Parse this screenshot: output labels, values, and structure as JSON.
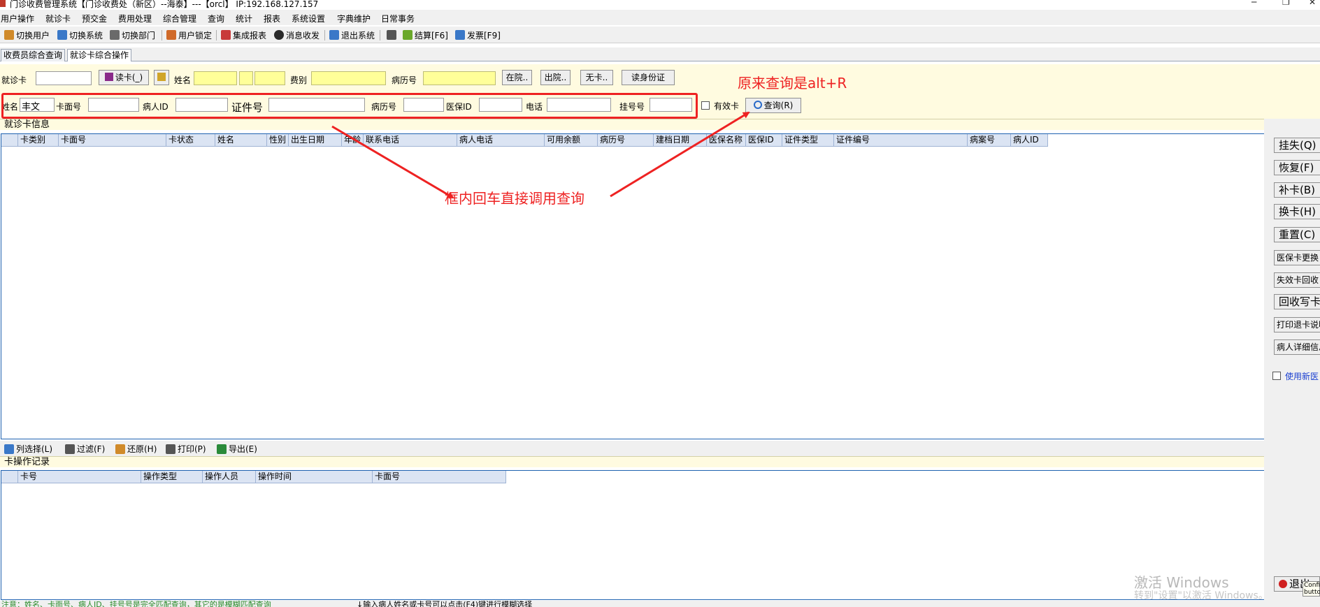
{
  "titlebar": {
    "title": "门诊收费管理系统【门诊收费处（新区）--海泰】---【orcl】 IP:192.168.127.157",
    "minimize": "─",
    "maximize": "❐",
    "close": "✕"
  },
  "menu": [
    "用户操作",
    "就诊卡",
    "预交金",
    "费用处理",
    "综合管理",
    "查询",
    "统计",
    "报表",
    "系统设置",
    "字典维护",
    "日常事务"
  ],
  "toolbar": [
    {
      "label": "切换用户",
      "icon": "user-switch-icon",
      "color": "#d08a2a"
    },
    {
      "label": "切换系统",
      "icon": "system-switch-icon",
      "color": "#3a78c8"
    },
    {
      "label": "切换部门",
      "icon": "department-switch-icon",
      "color": "#6a6a6a"
    },
    {
      "label": "用户锁定",
      "icon": "lock-user-icon",
      "color": "#d06a2a"
    },
    {
      "label": "集成报表",
      "icon": "report-icon",
      "color": "#c83a3a"
    },
    {
      "label": "消息收发",
      "icon": "info-icon",
      "color": "#2a2a2a"
    },
    {
      "label": "退出系统",
      "icon": "exit-icon",
      "color": "#3a78c8"
    },
    {
      "label": "",
      "icon": "edit-icon",
      "color": "#555555"
    },
    {
      "label": "结算[F6]",
      "icon": "settle-icon",
      "color": "#6aa82a"
    },
    {
      "label": "发票[F9]",
      "icon": "invoice-icon",
      "color": "#3a78c8"
    }
  ],
  "tabs": [
    "收费员综合查询",
    "就诊卡综合操作"
  ],
  "row1": {
    "card_label": "就诊卡",
    "read_card": "读卡(_)",
    "name_label": "姓名",
    "feetype_label": "费别",
    "record_label": "病历号",
    "btn_inhosp": "在院..",
    "btn_discharge": "出院..",
    "btn_nocard": "无卡..",
    "btn_idcard": "读身份证"
  },
  "row2": {
    "name_label": "姓名",
    "name_value": "丰文",
    "cardface_label": "卡面号",
    "patientid_label": "病人ID",
    "cert_label": "证件号",
    "record_label": "病历号",
    "insurance_label": "医保ID",
    "phone_label": "电话",
    "regno_label": "挂号号",
    "valid_label": "有效卡",
    "query_btn": "查询(R)"
  },
  "annotations": {
    "original": "原来查询是alt+R",
    "enter_query": "框内回车直接调用查询"
  },
  "card_info": {
    "title": "就诊卡信息",
    "columns": [
      "卡类别",
      "卡面号",
      "卡状态",
      "姓名",
      "性别",
      "出生日期",
      "年龄",
      "联系电话",
      "病人电话",
      "可用余额",
      "病历号",
      "建档日期",
      "医保名称",
      "医保ID",
      "证件类型",
      "证件编号",
      "病案号",
      "病人ID"
    ]
  },
  "subtoolbar": [
    {
      "label": "列选择(L)",
      "icon": "columns-icon",
      "color": "#3a78c8"
    },
    {
      "label": "过滤(F)",
      "icon": "filter-icon",
      "color": "#555555"
    },
    {
      "label": "还原(H)",
      "icon": "restore-icon",
      "color": "#d08a2a"
    },
    {
      "label": "打印(P)",
      "icon": "print-icon",
      "color": "#555555"
    },
    {
      "label": "导出(E)",
      "icon": "export-icon",
      "color": "#2a8a3a"
    }
  ],
  "op_log": {
    "title": "卡操作记录",
    "columns": [
      "卡号",
      "操作类型",
      "操作人员",
      "操作时间",
      "卡面号"
    ]
  },
  "side_buttons": [
    "挂失(Q)",
    "恢复(F)",
    "补卡(B)",
    "换卡(H)",
    "重置(C)",
    "医保卡更换",
    "失效卡回收",
    "回收写卡",
    "打印退卡说明",
    "病人详细信息"
  ],
  "side_checkbox": "使用新医",
  "exit_button": "退出",
  "tooltip": "Confi butto",
  "status": {
    "left": "注意：姓名、卡面号、病人ID、挂号号是完全匹配查询，其它的是模糊匹配查询",
    "right": "↓输入病人姓名或卡号可以点击(F4)键进行模糊选择"
  },
  "watermark": {
    "line1": "激活 Windows",
    "line2": "转到\"设置\"以激活 Windows。"
  }
}
